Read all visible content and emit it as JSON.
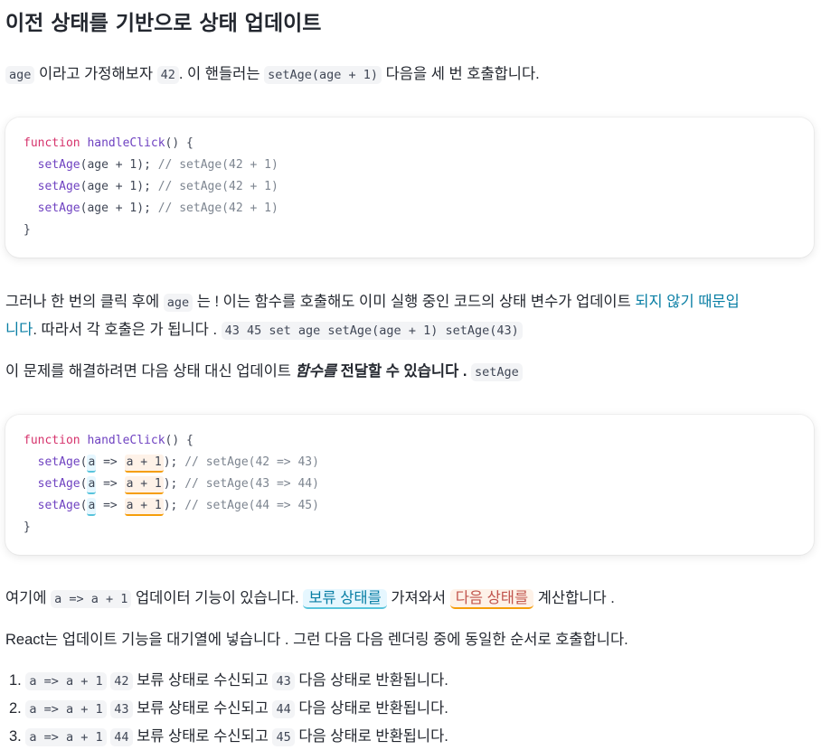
{
  "heading": "이전 상태를 기반으로 상태 업데이트",
  "p1": {
    "code_age": "age",
    "t1": " 이라고 가정해보자 ",
    "code_42": "42",
    "t2": ". 이 핸들러는 ",
    "code_call": "setAge(age + 1)",
    "t3": " 다음을 세 번 호출합니다."
  },
  "code1": {
    "line0_kw": "function",
    "line0_fn": "handleClick",
    "line0_rest": "() {",
    "lines": [
      {
        "fn": "setAge",
        "args": "(age + ",
        "num": "1",
        "end": "); ",
        "comment": "// setAge(42 + 1)"
      },
      {
        "fn": "setAge",
        "args": "(age + ",
        "num": "1",
        "end": "); ",
        "comment": "// setAge(42 + 1)"
      },
      {
        "fn": "setAge",
        "args": "(age + ",
        "num": "1",
        "end": "); ",
        "comment": "// setAge(42 + 1)"
      }
    ],
    "close": "}"
  },
  "p2": {
    "t1": "그러나 한 번의 클릭 후에 ",
    "code_age": "age",
    "t2": " 는 ! 이는 함수를 호출해도 이미 실행 중인 코드의 상태 변수가 업데이트 ",
    "link1": "되지 않기 때문입",
    "link2": "니다",
    "t3": ". 따라서 각 호출은 가 됩니다 . ",
    "code_tail": "43 45 set age setAge(age + 1) setAge(43)"
  },
  "p3": {
    "t1": "이 문제를 해결하려면 다음 상태 대신 업데이트 ",
    "em": "함수를",
    "strong": " 전달할 수 있습니다 .",
    "code": "setAge"
  },
  "code2": {
    "line0_kw": "function",
    "line0_fn": "handleClick",
    "line0_rest": "() {",
    "lines": [
      {
        "fn": "setAge",
        "open": "(",
        "param": "a",
        "arrow": " => ",
        "body": "a + 1",
        "end": "); ",
        "comment": "// setAge(42 => 43)"
      },
      {
        "fn": "setAge",
        "open": "(",
        "param": "a",
        "arrow": " => ",
        "body": "a + 1",
        "end": "); ",
        "comment": "// setAge(43 => 44)"
      },
      {
        "fn": "setAge",
        "open": "(",
        "param": "a",
        "arrow": " => ",
        "body": "a + 1",
        "end": "); ",
        "comment": "// setAge(44 => 45)"
      }
    ],
    "close": "}"
  },
  "p4": {
    "t1": "여기에 ",
    "code": "a => a + 1",
    "t2": " 업데이터 기능이 있습니다. ",
    "pill_blue": "보류 상태를",
    "t3": " 가져와서 ",
    "pill_orange": "다음 상태를",
    "t4": " 계산합니다 ."
  },
  "p5": "React는 업데이트 기능을 대기열에 넣습니다 . 그런 다음 다음 렌더링 중에 동일한 순서로 호출합니다.",
  "list": [
    {
      "num": "1.",
      "code_fn": "a => a + 1",
      "code_in": "42",
      "t1": " 보류 상태로 수신되고 ",
      "code_out": "43",
      "t2": " 다음 상태로 반환됩니다."
    },
    {
      "num": "2.",
      "code_fn": "a => a + 1",
      "code_in": "43",
      "t1": " 보류 상태로 수신되고 ",
      "code_out": "44",
      "t2": " 다음 상태로 반환됩니다."
    },
    {
      "num": "3.",
      "code_fn": "a => a + 1",
      "code_in": "44",
      "t1": " 보류 상태로 수신되고 ",
      "code_out": "45",
      "t2": " 다음 상태로 반환됩니다."
    }
  ],
  "colors": {
    "text": "#23272f",
    "link": "#087ea4",
    "keyword": "#d6336c",
    "function": "#6f42c1",
    "comment": "#7d8590",
    "pending_bg": "#e6f7ff",
    "next_bg": "#fef2e8"
  }
}
